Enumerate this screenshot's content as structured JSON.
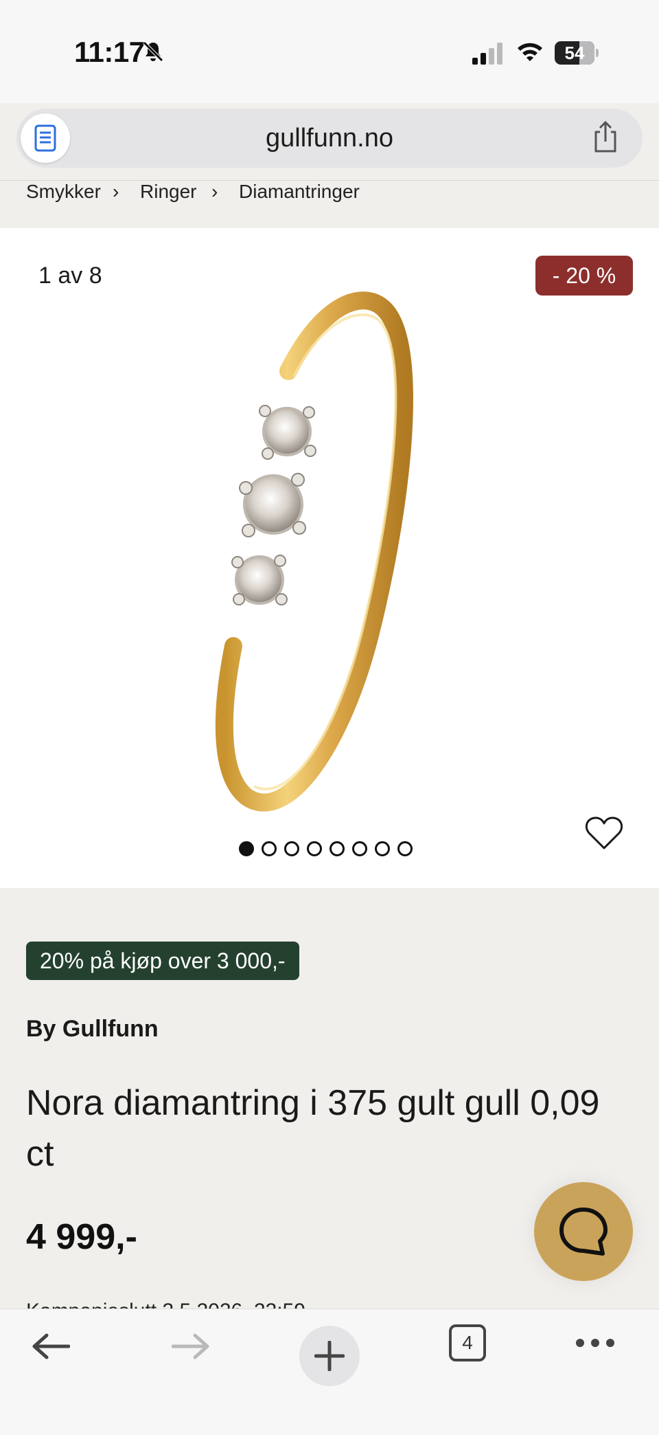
{
  "status_bar": {
    "time": "11:17",
    "battery_level": "54",
    "icons": [
      "bell-slash-icon",
      "cellular-signal-icon",
      "wifi-icon",
      "battery-icon"
    ]
  },
  "browser": {
    "url": "gullfunn.no",
    "open_tabs": "4",
    "icons": [
      "reader-icon",
      "share-icon",
      "back-arrow-icon",
      "forward-arrow-icon",
      "plus-icon",
      "tabs-icon",
      "more-icon"
    ]
  },
  "breadcrumb": {
    "items": [
      "Smykker",
      "Ringer",
      "Diamantringer"
    ],
    "separator": "›"
  },
  "gallery": {
    "counter": "1 av 8",
    "discount": "- 20 %",
    "image_count": 8,
    "active_index": 0
  },
  "product": {
    "promo": "20% på kjøp over 3 000,-",
    "brand": "By Gullfunn",
    "title": "Nora diamantring i 375 gult gull 0,09 ct",
    "price": "4 999,-",
    "campaign_end": "Kampanjeslutt 3.5.2026, 23:59"
  },
  "colors": {
    "discount_bg": "#8c2f2c",
    "promo_bg": "#24412f",
    "chat_bg": "#caa35a",
    "page_bg": "#f1efec"
  }
}
